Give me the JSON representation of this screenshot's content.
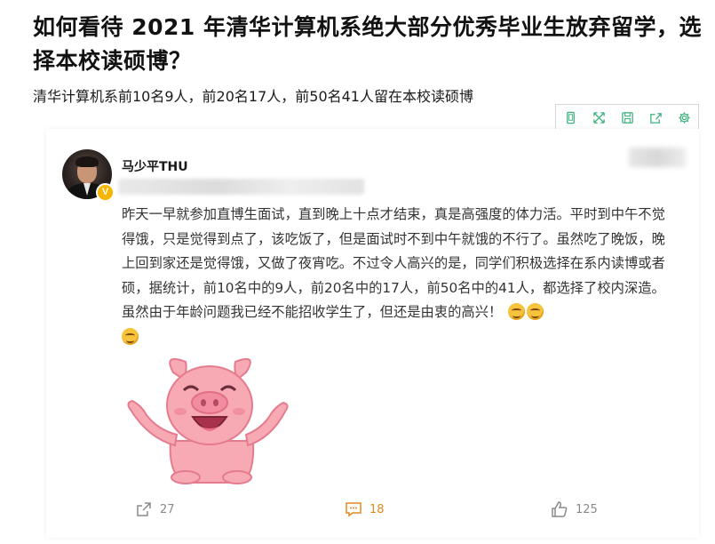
{
  "question": {
    "title": "如何看待 2021 年清华计算机系绝大部分优秀毕业生放弃留学，选择本校读硕博？",
    "subtitle": "清华计算机系前10名9人，前20名17人，前50名41人留在本校读硕博"
  },
  "toolbar": {
    "buttons": [
      {
        "icon": "phone-icon"
      },
      {
        "icon": "expand-icon"
      },
      {
        "icon": "save-icon"
      },
      {
        "icon": "share-icon"
      },
      {
        "icon": "settings-icon"
      }
    ]
  },
  "post": {
    "author": "马少平THU",
    "verified_badge": "V",
    "text": "昨天一早就参加直博生面试，直到晚上十点才结束，真是高强度的体力活。平时到中午不觉得饿，只是觉得到点了，该吃饭了，但是面试时不到中午就饿的不行了。虽然吃了晚饭，晚上回到家还是觉得饿，又做了夜宵吃。不过令人高兴的是，同学们积极选择在系内读博或者硕，据统计，前10名中的9人，前20名中的17人，前50名中的41人，都选择了校内深造。虽然由于年龄问题我已经不能招收学生了，但还是由衷的高兴！",
    "emoji": [
      "hug-emoji",
      "hug-emoji",
      "hug-emoji"
    ],
    "image": "cartoon-pig",
    "actions": {
      "repost_count": "27",
      "comment_count": "18",
      "like_count": "125"
    }
  },
  "colors": {
    "toolbar_icon": "#3fb37f",
    "comment_accent": "#e08a1e",
    "badge": "#f7b500",
    "pig": "#f7a9b4"
  }
}
